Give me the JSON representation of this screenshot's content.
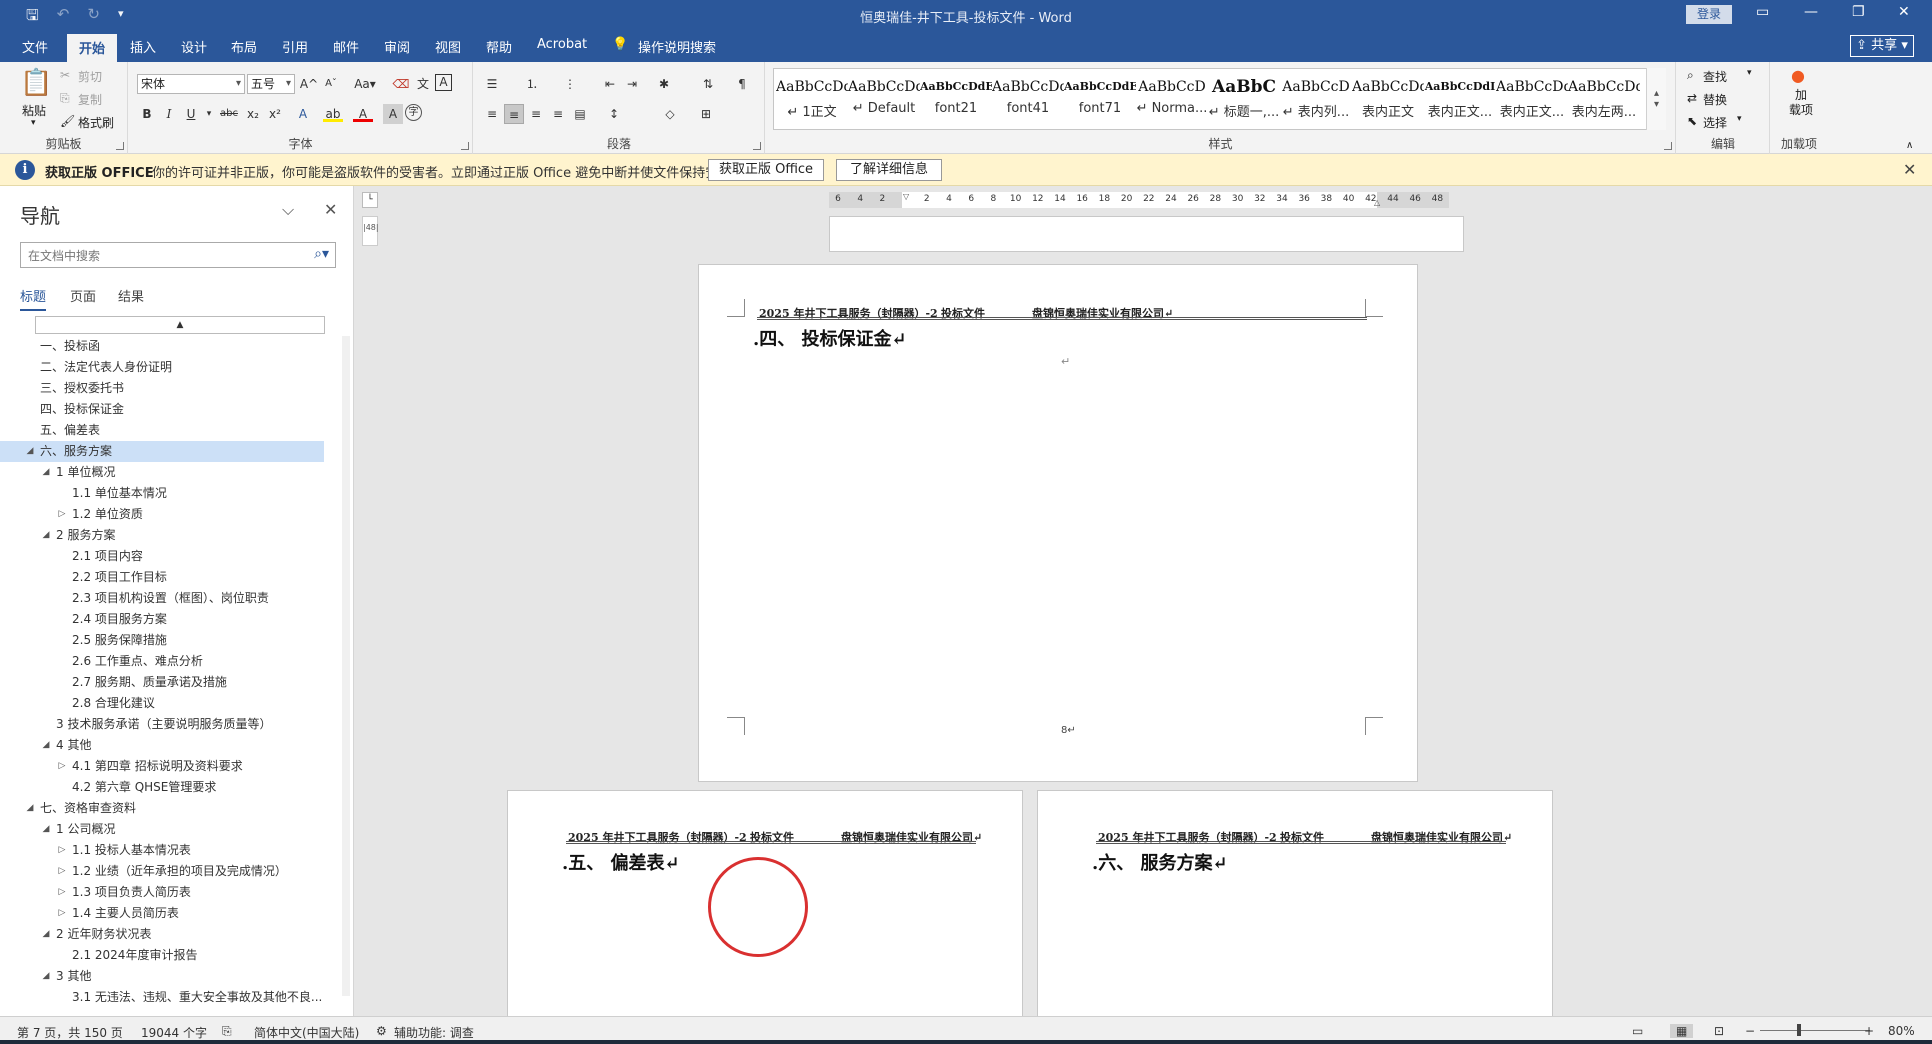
{
  "titlebar": {
    "title": "恒奥瑞佳-井下工具-投标文件  -  Word",
    "login": "登录",
    "qat": {
      "save_icon": "save-icon",
      "undo_icon": "undo-icon",
      "redo_icon": "redo-icon",
      "customize_icon": "customize-qat-icon"
    },
    "window_controls": [
      "ribbon-display-icon",
      "minimize-icon",
      "restore-icon",
      "close-icon"
    ]
  },
  "tabs": [
    "文件",
    "开始",
    "插入",
    "设计",
    "布局",
    "引用",
    "邮件",
    "审阅",
    "视图",
    "帮助",
    "Acrobat"
  ],
  "active_tab": "开始",
  "tellme": "操作说明搜索",
  "share": "共享",
  "clipboard": {
    "paste": "粘贴",
    "cut": "剪切",
    "copy": "复制",
    "format_painter": "格式刷",
    "label": "剪贴板"
  },
  "font": {
    "name": "宋体",
    "size": "五号",
    "label": "字体",
    "grow": "A",
    "shrink": "A",
    "case": "Aa",
    "bold": "B",
    "italic": "I",
    "underline": "U",
    "strike": "abc",
    "subscript": "x₂",
    "superscript": "x²",
    "text_effects": "A",
    "highlight": "ab",
    "font_color": "A",
    "shade": "A",
    "enclose": "字"
  },
  "paragraph": {
    "label": "段落"
  },
  "styles": {
    "label": "样式",
    "items": [
      {
        "sample": "AaBbCcDd",
        "name": "↵ 1正文"
      },
      {
        "sample": "AaBbCcDd",
        "name": "↵ Default"
      },
      {
        "sample": "AaBbCcDdE",
        "name": "font21"
      },
      {
        "sample": "AaBbCcDd",
        "name": "font41"
      },
      {
        "sample": "AaBbCcDdEe",
        "name": "font71"
      },
      {
        "sample": "AaBbCcD",
        "name": "↵ Norma..."
      },
      {
        "sample": "AaBbC",
        "name": "↵ 标题一,..."
      },
      {
        "sample": "AaBbCcD",
        "name": "↵ 表内列..."
      },
      {
        "sample": "AaBbCcDd",
        "name": "表内正文"
      },
      {
        "sample": "AaBbCcDdI",
        "name": "表内正文..."
      },
      {
        "sample": "AaBbCcDd",
        "name": "表内正文..."
      },
      {
        "sample": "AaBbCcDdI",
        "name": "表内左两..."
      }
    ]
  },
  "editing": {
    "find": "查找",
    "replace": "替换",
    "select": "选择",
    "label": "编辑"
  },
  "addins": {
    "button": "加\n载项",
    "label": "加载项"
  },
  "message_bar": {
    "title": "获取正版 OFFICE",
    "text": "你的许可证并非正版，你可能是盗版软件的受害者。立即通过正版 Office 避免中断并使文件保持安全。",
    "btn_get": "获取正版 Office",
    "btn_more": "了解详细信息"
  },
  "nav": {
    "title": "导航",
    "search_placeholder": "在文档中搜索",
    "tabs": [
      "标题",
      "页面",
      "结果"
    ],
    "tree": [
      {
        "text": "一、投标函",
        "level": 0,
        "tw": ""
      },
      {
        "text": "二、法定代表人身份证明",
        "level": 0,
        "tw": ""
      },
      {
        "text": "三、授权委托书",
        "level": 0,
        "tw": ""
      },
      {
        "text": "四、投标保证金",
        "level": 0,
        "tw": ""
      },
      {
        "text": "五、偏差表",
        "level": 0,
        "tw": ""
      },
      {
        "text": "六、服务方案",
        "level": 0,
        "tw": "◢",
        "selected": true
      },
      {
        "text": "1 单位概况",
        "level": 1,
        "tw": "◢"
      },
      {
        "text": "1.1 单位基本情况",
        "level": 2,
        "tw": ""
      },
      {
        "text": "1.2 单位资质",
        "level": 2,
        "tw": "▷"
      },
      {
        "text": "2 服务方案",
        "level": 1,
        "tw": "◢"
      },
      {
        "text": "2.1 项目内容",
        "level": 2,
        "tw": ""
      },
      {
        "text": "2.2 项目工作目标",
        "level": 2,
        "tw": ""
      },
      {
        "text": "2.3 项目机构设置（框图）、岗位职责",
        "level": 2,
        "tw": ""
      },
      {
        "text": "2.4 项目服务方案",
        "level": 2,
        "tw": ""
      },
      {
        "text": "2.5 服务保障措施",
        "level": 2,
        "tw": ""
      },
      {
        "text": "2.6 工作重点、难点分析",
        "level": 2,
        "tw": ""
      },
      {
        "text": "2.7 服务期、质量承诺及措施",
        "level": 2,
        "tw": ""
      },
      {
        "text": "2.8 合理化建议",
        "level": 2,
        "tw": ""
      },
      {
        "text": "3 技术服务承诺（主要说明服务质量等）",
        "level": 1,
        "tw": ""
      },
      {
        "text": "4 其他",
        "level": 1,
        "tw": "◢"
      },
      {
        "text": "4.1 第四章  招标说明及资料要求",
        "level": 2,
        "tw": "▷"
      },
      {
        "text": "4.2 第六章  QHSE管理要求",
        "level": 2,
        "tw": ""
      },
      {
        "text": "七、资格审查资料",
        "level": 0,
        "tw": "◢"
      },
      {
        "text": "1 公司概况",
        "level": 1,
        "tw": "◢"
      },
      {
        "text": "1.1 投标人基本情况表",
        "level": 2,
        "tw": "▷"
      },
      {
        "text": "1.2 业绩（近年承担的项目及完成情况）",
        "level": 2,
        "tw": "▷"
      },
      {
        "text": "1.3 项目负责人简历表",
        "level": 2,
        "tw": "▷"
      },
      {
        "text": "1.4 主要人员简历表",
        "level": 2,
        "tw": "▷"
      },
      {
        "text": "2 近年财务状况表",
        "level": 1,
        "tw": "◢"
      },
      {
        "text": "2.1 2024年度审计报告",
        "level": 2,
        "tw": ""
      },
      {
        "text": "3 其他",
        "level": 1,
        "tw": "◢"
      },
      {
        "text": "3.1 无违法、违规、重大安全事故及其他不良...",
        "level": 2,
        "tw": ""
      }
    ]
  },
  "ruler": {
    "ticks": [
      "6",
      "4",
      "2",
      "",
      "2",
      "4",
      "6",
      "8",
      "10",
      "12",
      "14",
      "16",
      "18",
      "20",
      "22",
      "24",
      "26",
      "28",
      "30",
      "32",
      "34",
      "36",
      "38",
      "40",
      "42",
      "44",
      "46",
      "48"
    ],
    "vruler_label": "|48|"
  },
  "document": {
    "header_left": "2025 年井下工具服务（封隔器）-2",
    "header_mid": "投标文件",
    "header_right": "盘锦恒奥瑞佳实业有限公司↵",
    "page_main_heading": ".四、  投标保证金↵",
    "page_main_number": "8↵",
    "para_mark": "↵",
    "page_left_heading": ".五、  偏差表↵",
    "page_right_heading": ".六、  服务方案↵"
  },
  "statusbar": {
    "page": "第 7 页，共 150 页",
    "words": "19044 个字",
    "lang": "简体中文(中国大陆)",
    "accessibility": "辅助功能: 调查",
    "zoom": "80%",
    "zoom_minus": "−",
    "zoom_plus": "+"
  }
}
